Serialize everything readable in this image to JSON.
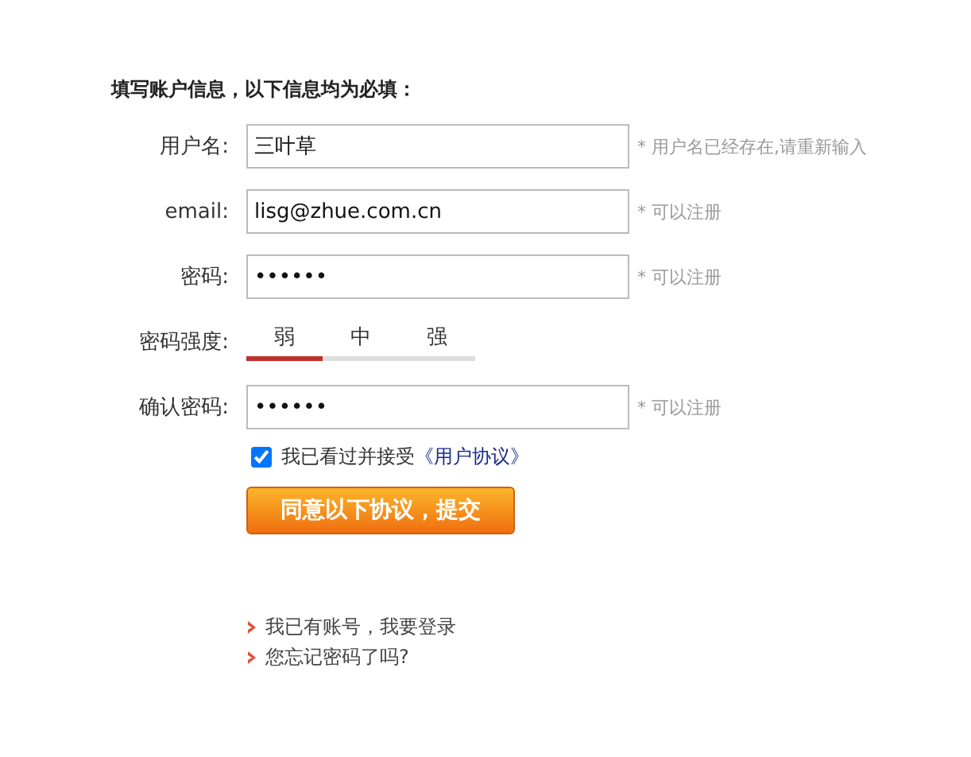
{
  "heading": "填写账户信息，以下信息均为必填：",
  "fields": [
    {
      "label": "用户名:",
      "value": "三叶草",
      "hint": "* 用户名已经存在,请重新输入"
    },
    {
      "label": "email:",
      "value": "lisg@zhue.com.cn",
      "hint": "* 可以注册"
    },
    {
      "label": "密码:",
      "value": "••••••",
      "hint": "* 可以注册"
    },
    {
      "label": "密码强度:",
      "kind": "strength",
      "levels": [
        {
          "label": "弱",
          "selected": true
        },
        {
          "label": "中",
          "selected": false
        },
        {
          "label": "强",
          "selected": false
        }
      ]
    },
    {
      "label": "确认密码:",
      "value": "••••••",
      "hint": "* 可以注册"
    }
  ],
  "agreement": {
    "checked": true,
    "text": "我已看过并接受",
    "link": "《用户协议》"
  },
  "submit_button": "同意以下协议，提交",
  "links": [
    "我已有账号，我要登录",
    "您忘记密码了吗?"
  ]
}
